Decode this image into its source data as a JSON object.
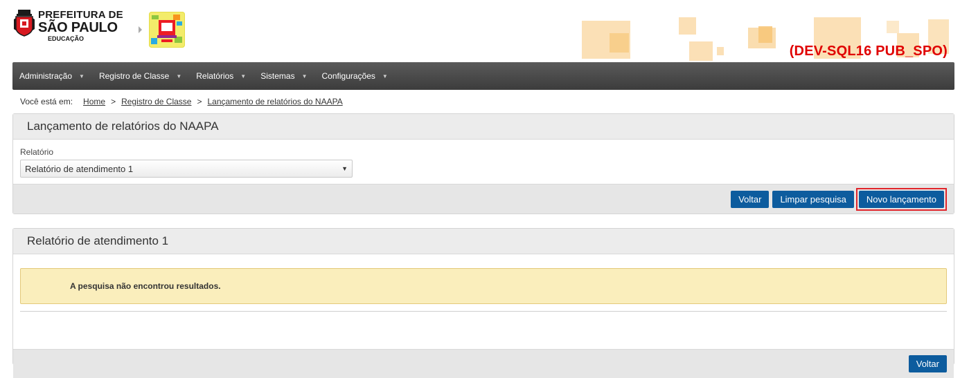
{
  "header": {
    "logo_line1": "PREFEITURA DE",
    "logo_line2": "SÃO PAULO",
    "logo_line3": "EDUCAÇÃO",
    "env_tag": "(DEV-SQL16 PUB_SPO)",
    "env_color": "#e00000"
  },
  "nav": {
    "items": [
      {
        "label": "Administração"
      },
      {
        "label": "Registro de Classe"
      },
      {
        "label": "Relatórios"
      },
      {
        "label": "Sistemas"
      },
      {
        "label": "Configurações"
      }
    ],
    "caret": "▼"
  },
  "breadcrumb": {
    "prefix": "Você está em:",
    "items": [
      "Home",
      "Registro de Classe",
      "Lançamento de relatórios do NAAPA"
    ],
    "separator": ">"
  },
  "search_panel": {
    "title": "Lançamento de relatórios do NAAPA",
    "field_label": "Relatório",
    "select_value": "Relatório de atendimento 1",
    "buttons": {
      "back": "Voltar",
      "clear": "Limpar pesquisa",
      "new": "Novo lançamento"
    }
  },
  "results_panel": {
    "title": "Relatório de atendimento 1",
    "alert_text": "A pesquisa não encontrou resultados.",
    "back_button": "Voltar"
  },
  "colors": {
    "primary_button": "#0d5c9e",
    "highlight_border": "#e0242a",
    "alert_bg": "#faeebc",
    "navbar": "#4a4a4a"
  }
}
